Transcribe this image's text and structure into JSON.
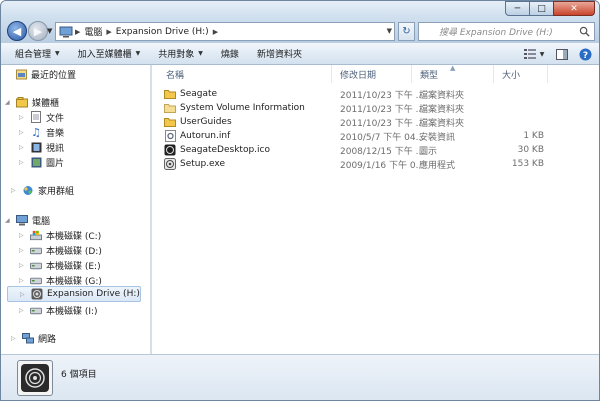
{
  "address": {
    "segments": [
      "電腦",
      "Expansion Drive (H:)"
    ],
    "search_placeholder": "搜尋 Expansion Drive (H:)"
  },
  "toolbar": {
    "organize": "組合管理",
    "include_library": "加入至媒體櫃",
    "share_with": "共用對象",
    "burn": "燒錄",
    "new_folder": "新增資料夾"
  },
  "nav": {
    "recent": "最近的位置",
    "libraries": "媒體櫃",
    "documents": "文件",
    "music": "音樂",
    "videos": "視訊",
    "pictures": "圖片",
    "homegroup": "家用群組",
    "computer": "電腦",
    "drive_c": "本機磁碟 (C:)",
    "drive_d": "本機磁碟 (D:)",
    "drive_e": "本機磁碟 (E:)",
    "drive_g": "本機磁碟 (G:)",
    "drive_h": "Expansion Drive (H:)",
    "drive_i": "本機磁碟 (I:)",
    "network": "網路"
  },
  "columns": {
    "name": "名稱",
    "date": "修改日期",
    "type": "類型",
    "size": "大小"
  },
  "files": [
    {
      "name": "Seagate",
      "date": "2011/10/23 下午 ...",
      "type": "檔案資料夾",
      "size": "",
      "icon": "folder-icon"
    },
    {
      "name": "System Volume Information",
      "date": "2011/10/23 下午 ...",
      "type": "檔案資料夾",
      "size": "",
      "icon": "folder-icon"
    },
    {
      "name": "UserGuides",
      "date": "2011/10/23 下午 ...",
      "type": "檔案資料夾",
      "size": "",
      "icon": "folder-icon"
    },
    {
      "name": "Autorun.inf",
      "date": "2010/5/7 下午 04...",
      "type": "安裝資訊",
      "size": "1 KB",
      "icon": "settings-file-icon"
    },
    {
      "name": "SeagateDesktop.ico",
      "date": "2008/12/15 下午 ...",
      "type": "圖示",
      "size": "30 KB",
      "icon": "ico-file-icon"
    },
    {
      "name": "Setup.exe",
      "date": "2009/1/16 下午 0...",
      "type": "應用程式",
      "size": "153 KB",
      "icon": "exe-file-icon"
    }
  ],
  "status": {
    "item_count": "6 個項目"
  }
}
